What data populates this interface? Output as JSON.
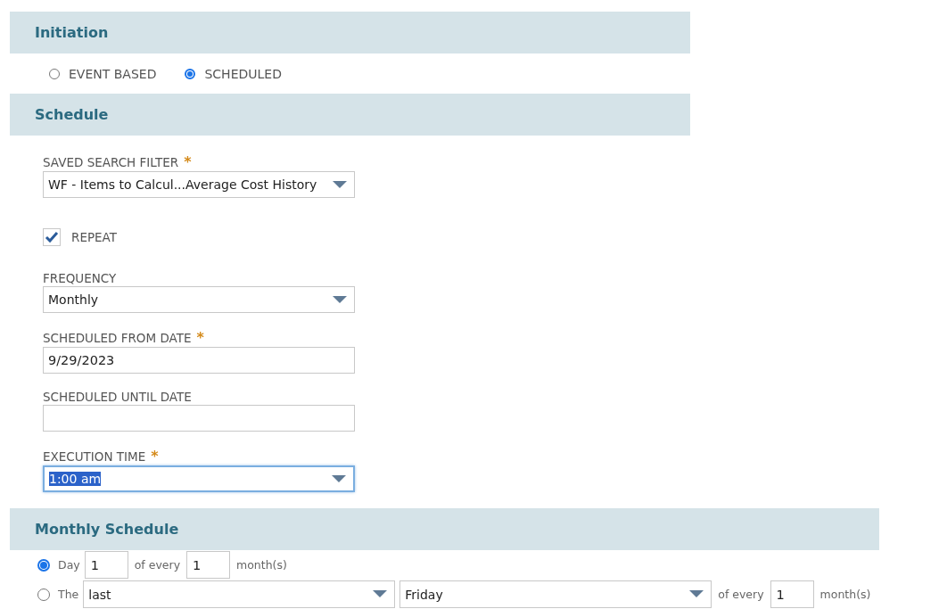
{
  "initiation": {
    "title": "Initiation",
    "options": [
      {
        "label": "EVENT BASED",
        "selected": false
      },
      {
        "label": "SCHEDULED",
        "selected": true
      }
    ]
  },
  "schedule": {
    "title": "Schedule",
    "fields": [
      {
        "kind": "select",
        "label": "SAVED SEARCH FILTER",
        "required_mark": "*",
        "value": "WF - Items to Calcul...Average Cost History"
      },
      {
        "kind": "checkbox",
        "label": "REPEAT",
        "checked": true
      },
      {
        "kind": "select",
        "label": "FREQUENCY",
        "value": "Monthly"
      },
      {
        "kind": "text",
        "label": "SCHEDULED FROM DATE",
        "required_mark": "*",
        "value": "9/29/2023"
      },
      {
        "kind": "text",
        "label": "SCHEDULED UNTIL DATE"
      },
      {
        "kind": "select",
        "label": "EXECUTION TIME",
        "required_mark": "*",
        "value": "1:00 am",
        "focused": true
      }
    ]
  },
  "monthly_schedule": {
    "title": "Monthly Schedule",
    "rows": [
      {
        "selected": true,
        "label": "Day",
        "items": [
          {
            "kind": "input",
            "value": "1"
          },
          {
            "kind": "text",
            "text": "of every"
          },
          {
            "kind": "input",
            "value": "1"
          },
          {
            "kind": "text",
            "text": "month(s)"
          }
        ]
      },
      {
        "selected": false,
        "label": "The",
        "items": [
          {
            "kind": "select",
            "value": "last"
          },
          {
            "kind": "select",
            "value": "Friday"
          },
          {
            "kind": "text",
            "text": "of every"
          },
          {
            "kind": "input",
            "value": "1"
          },
          {
            "kind": "text",
            "text": "month(s)"
          }
        ]
      }
    ]
  }
}
